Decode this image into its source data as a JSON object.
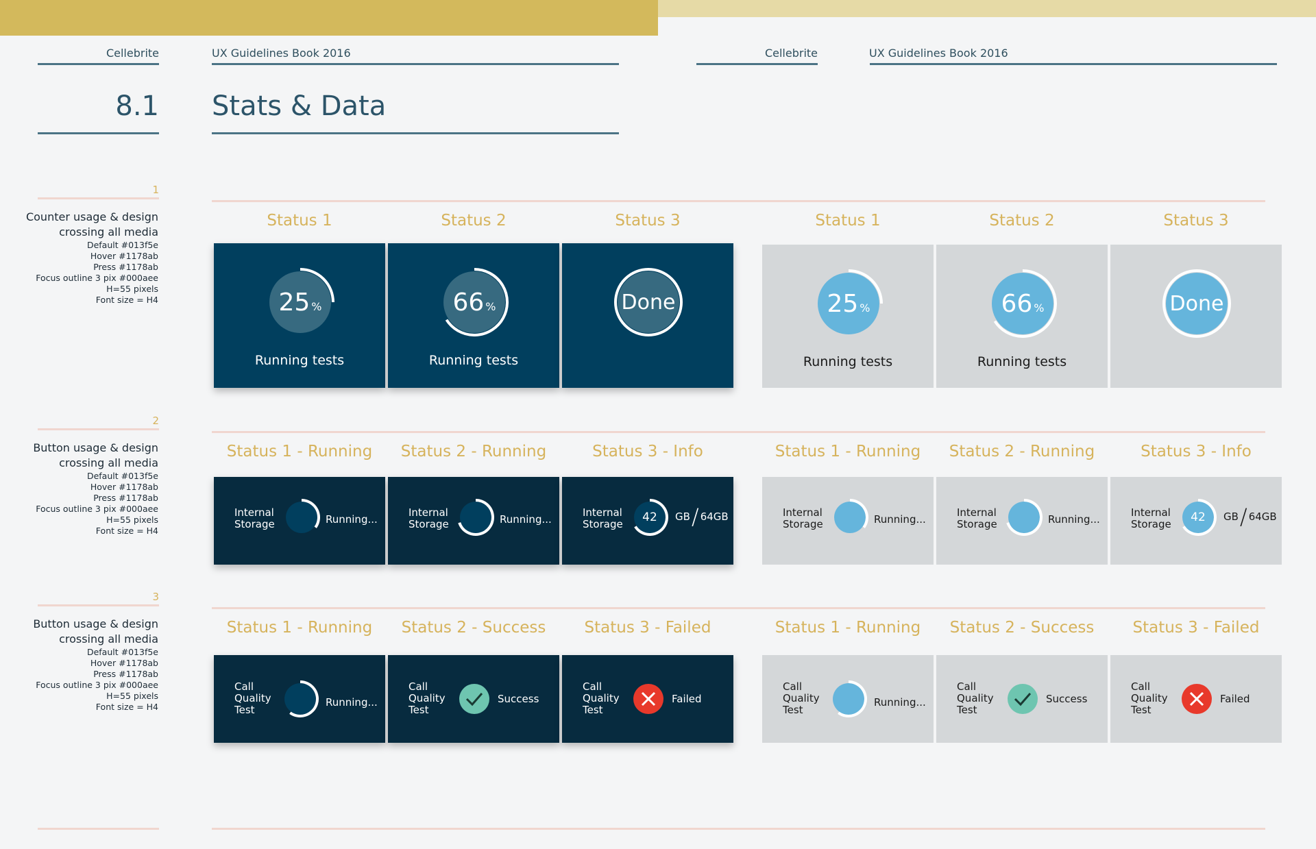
{
  "header": {
    "left_brand": "Cellebrite",
    "left_book": "UX Guidelines Book 2016",
    "right_brand": "Cellebrite",
    "right_book": "UX Guidelines Book 2016"
  },
  "section": {
    "number": "8.1",
    "title": "Stats & Data"
  },
  "sections": [
    {
      "index": "1",
      "title_lines": [
        "Counter usage & design",
        "crossing all media"
      ],
      "specs": [
        "Default #013f5e",
        "Hover #1178ab",
        "Press #1178ab",
        "Focus outline 3 pix #000aee",
        "H=55 pixels",
        "Font size = H4"
      ],
      "labels": [
        "Status 1",
        "Status 2",
        "Status 3",
        "Status 1",
        "Status 2",
        "Status 3"
      ],
      "cards": [
        {
          "value": "25",
          "unit": "%",
          "caption": "Running tests",
          "progress": 0.25
        },
        {
          "value": "66",
          "unit": "%",
          "caption": "Running tests",
          "progress": 0.66
        },
        {
          "value": "Done",
          "unit": "",
          "caption": "",
          "progress": 1.0
        },
        {
          "value": "25",
          "unit": "%",
          "caption": "Running tests",
          "progress": 0.25
        },
        {
          "value": "66",
          "unit": "%",
          "caption": "Running tests",
          "progress": 0.66
        },
        {
          "value": "Done",
          "unit": "",
          "caption": "",
          "progress": 1.0
        }
      ]
    },
    {
      "index": "2",
      "title_lines": [
        "Button usage & design",
        "crossing all media"
      ],
      "specs": [
        "Default #013f5e",
        "Hover #1178ab",
        "Press #1178ab",
        "Focus outline 3 pix #000aee",
        "H=55 pixels",
        "Font size = H4"
      ],
      "labels": [
        "Status 1 - Running",
        "Status 2 - Running",
        "Status 3 - Info",
        "Status 1 - Running",
        "Status 2 - Running",
        "Status 3 - Info"
      ],
      "cards": [
        {
          "label_lines": [
            "Internal",
            "Storage"
          ],
          "status": "Running...",
          "kind": "running",
          "progress": 0.35
        },
        {
          "label_lines": [
            "Internal",
            "Storage"
          ],
          "status": "Running...",
          "kind": "running",
          "progress": 0.7
        },
        {
          "label_lines": [
            "Internal",
            "Storage"
          ],
          "kind": "info",
          "number": "42",
          "unit": "GB",
          "total": "64GB",
          "progress": 0.66
        },
        {
          "label_lines": [
            "Internal",
            "Storage"
          ],
          "status": "Running...",
          "kind": "running",
          "progress": 0.35
        },
        {
          "label_lines": [
            "Internal",
            "Storage"
          ],
          "status": "Running...",
          "kind": "running",
          "progress": 0.7
        },
        {
          "label_lines": [
            "Internal",
            "Storage"
          ],
          "kind": "info",
          "number": "42",
          "unit": "GB",
          "total": "64GB",
          "progress": 0.66
        }
      ]
    },
    {
      "index": "3",
      "title_lines": [
        "Button usage & design",
        "crossing all media"
      ],
      "specs": [
        "Default #013f5e",
        "Hover #1178ab",
        "Press #1178ab",
        "Focus outline 3 pix #000aee",
        "H=55 pixels",
        "Font size = H4"
      ],
      "labels": [
        "Status 1 - Running",
        "Status 2 - Success",
        "Status 3 - Failed",
        "Status 1 - Running",
        "Status 2 - Success",
        "Status 3 - Failed"
      ],
      "cards": [
        {
          "label_lines": [
            "Call",
            "Quality",
            "Test"
          ],
          "status": "Running...",
          "kind": "running",
          "progress": 0.6
        },
        {
          "label_lines": [
            "Call",
            "Quality",
            "Test"
          ],
          "status": "Success",
          "kind": "success"
        },
        {
          "label_lines": [
            "Call",
            "Quality",
            "Test"
          ],
          "status": "Failed",
          "kind": "failed"
        },
        {
          "label_lines": [
            "Call",
            "Quality",
            "Test"
          ],
          "status": "Running...",
          "kind": "running",
          "progress": 0.6
        },
        {
          "label_lines": [
            "Call",
            "Quality",
            "Test"
          ],
          "status": "Success",
          "kind": "success"
        },
        {
          "label_lines": [
            "Call",
            "Quality",
            "Test"
          ],
          "status": "Failed",
          "kind": "failed"
        }
      ]
    }
  ],
  "colors": {
    "gold": "#d6b35c",
    "title_blue": "#2c5469",
    "card_blue": "#013f5e",
    "card_navy": "#072b3f",
    "card_grey": "#d4d7d9",
    "ring_dark": "#376a80",
    "ring_light": "#65b5dc",
    "ring_navy_fill": "#013f5e",
    "success": "#6ec5b0",
    "failed": "#e8392b"
  }
}
